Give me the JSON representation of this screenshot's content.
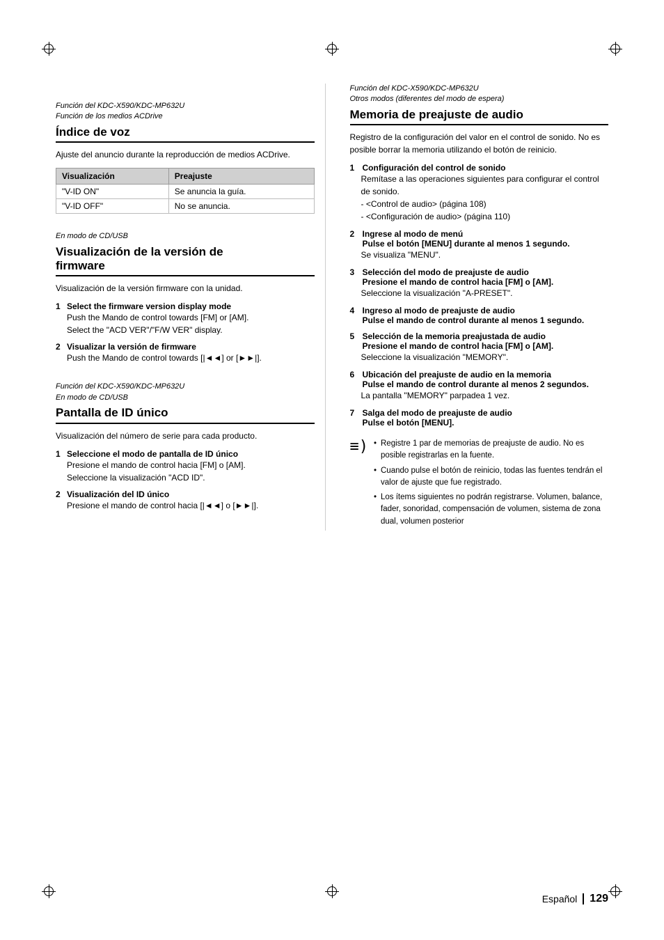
{
  "page": {
    "number": "129",
    "language": "Español"
  },
  "left_col": {
    "section1": {
      "header_line1": "Función del KDC-X590/KDC-MP632U",
      "header_line2": "Función de los medios ACDrive",
      "title": "Índice de voz",
      "description": "Ajuste del anuncio durante la reproducción de medios ACDrive.",
      "table": {
        "col1_header": "Visualización",
        "col2_header": "Preajuste",
        "rows": [
          [
            "\"V-ID ON\"",
            "Se anuncia la guía."
          ],
          [
            "\"V-ID OFF\"",
            "No se anuncia."
          ]
        ]
      }
    },
    "section2": {
      "header_line1": "En modo de CD/USB",
      "title_line1": "Visualización de la versión de",
      "title_line2": "firmware",
      "description": "Visualización de la versión firmware con la unidad.",
      "steps": [
        {
          "number": "1",
          "title": "Select the firmware version display mode",
          "body_lines": [
            "Push the Mando de control towards [FM] or [AM].",
            "Select the \"ACD VER\"/\"F/W VER\" display."
          ]
        },
        {
          "number": "2",
          "title": "Visualizar la versión de firmware",
          "body_lines": [
            "Push the Mando de control towards [|◄◄] or [►►|]."
          ]
        }
      ]
    },
    "section3": {
      "header_line1": "Función del KDC-X590/KDC-MP632U",
      "header_line2": "En modo de CD/USB",
      "title": "Pantalla de ID único",
      "description": "Visualización del número de serie para cada producto.",
      "steps": [
        {
          "number": "1",
          "title": "Seleccione el modo de pantalla de ID único",
          "body_lines": [
            "Presione el mando de control hacia [FM] o [AM].",
            "Seleccione la visualización \"ACD ID\"."
          ]
        },
        {
          "number": "2",
          "title": "Visualización del ID único",
          "body_lines": [
            "Presione el mando de control hacia [|◄◄] o [►►|]."
          ]
        }
      ]
    }
  },
  "right_col": {
    "section1": {
      "header_line1": "Función del KDC-X590/KDC-MP632U",
      "header_line2": "Otros modos (diferentes del modo de espera)",
      "title": "Memoria de preajuste de audio",
      "description": "Registro de la configuración del valor en el control de sonido. No es posible borrar la memoria utilizando el botón de reinicio.",
      "steps": [
        {
          "number": "1",
          "title": "Configuración del control de sonido",
          "body_lines": [
            "Remítase a las operaciones siguientes para configurar el control de sonido.",
            "- <Control de audio> (página 108)",
            "- <Configuración de audio> (página 110)"
          ]
        },
        {
          "number": "2",
          "title": "Ingrese al modo de menú",
          "sub_title": "Pulse el botón [MENU] durante al menos 1 segundo.",
          "body_lines": [
            "Se visualiza \"MENU\"."
          ]
        },
        {
          "number": "3",
          "title": "Selección del modo de preajuste de audio",
          "sub_title": "Presione el mando de control hacia [FM] o [AM].",
          "body_lines": [
            "Seleccione la visualización \"A-PRESET\"."
          ]
        },
        {
          "number": "4",
          "title": "Ingreso al modo de preajuste de audio",
          "sub_title": "Pulse el mando de control durante al menos 1 segundo.",
          "body_lines": []
        },
        {
          "number": "5",
          "title": "Selección de la memoria preajustada de audio",
          "sub_title": "Presione el mando de control hacia [FM] o [AM].",
          "body_lines": [
            "Seleccione la visualización \"MEMORY\"."
          ]
        },
        {
          "number": "6",
          "title": "Ubicación del preajuste de audio en la memoria",
          "sub_title": "Pulse el mando de control durante al menos 2 segundos.",
          "body_lines": [
            "La pantalla \"MEMORY\" parpadea 1 vez."
          ]
        },
        {
          "number": "7",
          "title": "Salga del modo de preajuste de audio",
          "sub_title": "Pulse el botón [MENU].",
          "body_lines": []
        }
      ],
      "notes": [
        "Registre 1 par de memorias de preajuste de audio. No es posible registrarlas en la fuente.",
        "Cuando pulse el botón de reinicio, todas las fuentes tendrán el valor de ajuste que fue registrado.",
        "Los ítems siguientes no podrán registrarse. Volumen, balance, fader, sonoridad, compensación de volumen, sistema de zona dual, volumen posterior"
      ]
    }
  }
}
